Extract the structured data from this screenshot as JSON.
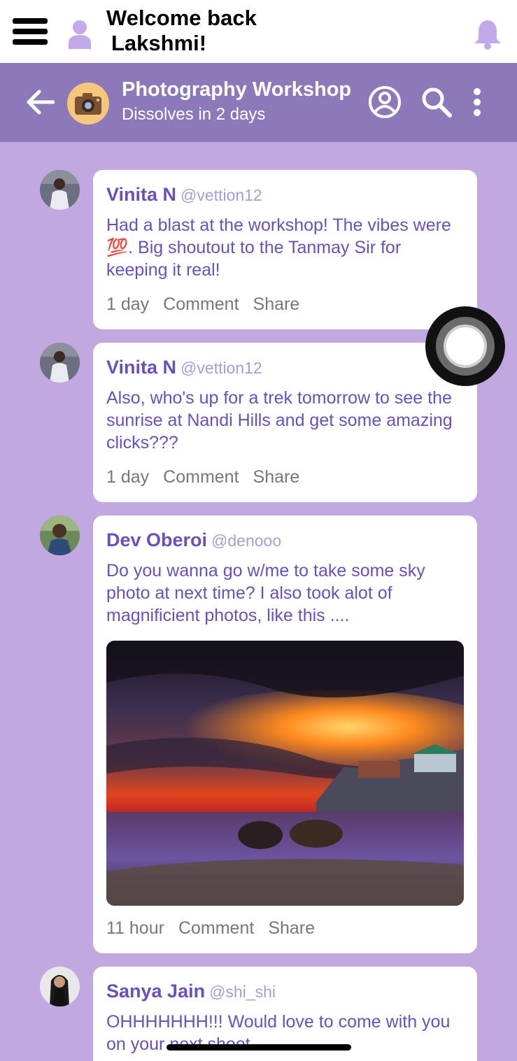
{
  "topbar": {
    "menu_icon": "hamburger-icon",
    "user_icon": "user-icon",
    "welcome_line1": "Welcome back",
    "welcome_line2": "Lakshmi!",
    "bell_icon": "bell-icon"
  },
  "group": {
    "title": "Photography Workshop",
    "subtitle": "Dissolves in 2 days",
    "avatar_icon": "camera-icon",
    "back_icon": "arrow-left-icon",
    "profile_icon": "user-circle-icon",
    "search_icon": "search-icon",
    "more_icon": "more-vertical-icon"
  },
  "colors": {
    "background": "#c1a8e1",
    "header": "#8b79b9",
    "accent": "#6a4fbf",
    "handle": "#a99bd9"
  },
  "posts": [
    {
      "name": "Vinita N",
      "handle": "@vettion12",
      "text": "Had a blast at the workshop! The vibes were 💯. Big shoutout to the Tanmay Sir for keeping it real!",
      "time": "1 day",
      "comment": "Comment",
      "share": "Share"
    },
    {
      "name": "Vinita N",
      "handle": "@vettion12",
      "text": "Also, who's up for a trek tomorrow to see the sunrise at Nandi Hills and get some amazing clicks???",
      "time": "1 day",
      "comment": "Comment",
      "share": "Share"
    },
    {
      "name": "Dev Oberoi",
      "handle": "@denooo",
      "text": "Do you wanna go w/me to take some sky photo at next time? I also took alot of magnificient photos, like this ....",
      "time": "11 hour",
      "comment": "Comment",
      "share": "Share"
    },
    {
      "name": "Sanya Jain",
      "handle": "@shi_shi",
      "text": "OHHHHHHH!!! Would love to come with you on your next shoot"
    }
  ]
}
